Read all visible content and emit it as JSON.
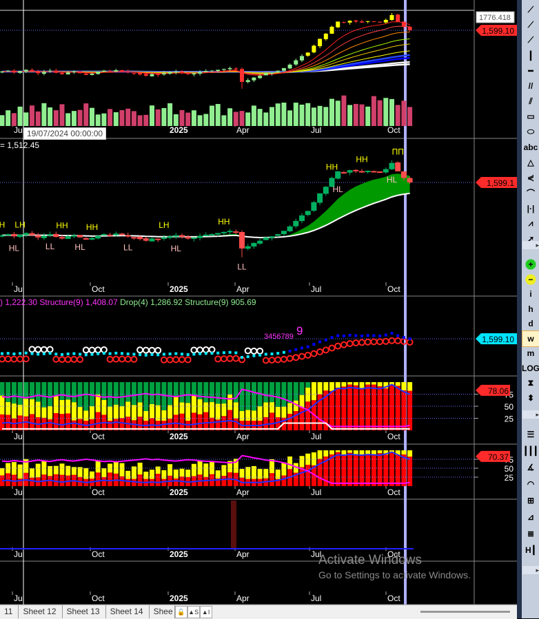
{
  "time_axis": [
    "Jul",
    "Oct",
    "2025",
    "Apr",
    "Jul",
    "Oct"
  ],
  "tooltip": "19/07/2024 00:00:00",
  "price_pane": {
    "high_label": "1776.418",
    "last_label": "1,599.10"
  },
  "swing_pane": {
    "header": "= 1,512.45",
    "last_label": "1,599.1",
    "swing_labels": [
      {
        "text": "H",
        "bar": 0,
        "kind": "high"
      },
      {
        "text": "LH",
        "bar": 3,
        "kind": "high"
      },
      {
        "text": "HL",
        "bar": 2,
        "kind": "low"
      },
      {
        "text": "LL",
        "bar": 8,
        "kind": "low"
      },
      {
        "text": "HH",
        "bar": 10,
        "kind": "high"
      },
      {
        "text": "HL",
        "bar": 13,
        "kind": "low"
      },
      {
        "text": "HH",
        "bar": 15,
        "kind": "high"
      },
      {
        "text": "LL",
        "bar": 21,
        "kind": "low"
      },
      {
        "text": "LH",
        "bar": 27,
        "kind": "high"
      },
      {
        "text": "HL",
        "bar": 29,
        "kind": "low"
      },
      {
        "text": "HH",
        "bar": 37,
        "kind": "high"
      },
      {
        "text": "LL",
        "bar": 40,
        "kind": "low"
      },
      {
        "text": "HH",
        "bar": 55,
        "kind": "high"
      },
      {
        "text": "HL",
        "bar": 56,
        "kind": "low"
      },
      {
        "text": "HH",
        "bar": 60,
        "kind": "high"
      },
      {
        "text": "HL",
        "bar": 65,
        "kind": "low"
      },
      {
        "text": "ПП",
        "bar": 66,
        "kind": "high"
      }
    ]
  },
  "structure_pane": {
    "header_parts": [
      {
        "text": ") 1,222.30 Structure(9) 1,408.07",
        "color": "#ff33ff"
      },
      {
        "text": " Drop(4) 1,286.92 Structure(9) 905.69",
        "color": "#90ee90"
      }
    ],
    "count_text": "3456789",
    "count_big": "9",
    "last_label": "1,599.10"
  },
  "osc1": {
    "last_label": "78.06",
    "levels": [
      "75",
      "50",
      "25"
    ]
  },
  "osc2": {
    "last_label": "70.37",
    "levels": [
      "75",
      "50",
      "25"
    ]
  },
  "closes": [
    1120,
    1130,
    1110,
    1125,
    1140,
    1120,
    1100,
    1115,
    1130,
    1105,
    1090,
    1110,
    1120,
    1100,
    1080,
    1095,
    1115,
    1130,
    1120,
    1135,
    1125,
    1110,
    1100,
    1085,
    1070,
    1090,
    1080,
    1100,
    1110,
    1120,
    1105,
    1090,
    1100,
    1115,
    1125,
    1130,
    1140,
    1150,
    1160,
    1145,
    1000,
    1020,
    1050,
    1070,
    1100,
    1110,
    1130,
    1160,
    1200,
    1250,
    1300,
    1340,
    1420,
    1500,
    1560,
    1640,
    1700,
    1690,
    1710,
    1700,
    1690,
    1705,
    1700,
    1690,
    1720,
    1776,
    1700,
    1640,
    1599
  ],
  "colors": {
    "up": "#00b060",
    "down": "#ff4c4c",
    "vol_up": "#90ee90",
    "vol_down": "#d0406a",
    "ribbon": "#009900",
    "label_red": "#ff2a2a",
    "label_cyan": "#00e5ff"
  },
  "tabs": [
    "11",
    "Sheet 12",
    "Sheet 13",
    "Sheet 14",
    "Shee"
  ],
  "tab_buttons": [
    "🔓",
    "▲S",
    "▲I"
  ],
  "toolbar": [
    {
      "icon": "line-segment-icon",
      "glyph": "⟋"
    },
    {
      "icon": "ray-icon",
      "glyph": "⟋"
    },
    {
      "icon": "extended-line-icon",
      "glyph": "⟋"
    },
    {
      "icon": "vertical-line-icon",
      "glyph": "┃"
    },
    {
      "icon": "horizontal-line-icon",
      "glyph": "━"
    },
    {
      "icon": "parallel-lines-icon",
      "glyph": "//"
    },
    {
      "icon": "pitchfork-icon",
      "glyph": "⫽"
    },
    {
      "icon": "rectangle-icon",
      "glyph": "▭"
    },
    {
      "icon": "ellipse-icon",
      "glyph": "⬭"
    },
    {
      "icon": "text-icon",
      "glyph": "abc"
    },
    {
      "icon": "triangle-icon",
      "glyph": "△"
    },
    {
      "icon": "gann-fan-icon",
      "glyph": "⋞"
    },
    {
      "icon": "arc-icon",
      "glyph": "⌒"
    },
    {
      "icon": "cycles-icon",
      "glyph": "|·|"
    },
    {
      "icon": "zigzag-icon",
      "glyph": "⩘"
    },
    {
      "icon": "arrow-icon",
      "glyph": "➚"
    }
  ],
  "toolbar2": [
    {
      "icon": "zoom-in-icon",
      "glyph": "+"
    },
    {
      "icon": "zoom-out-icon",
      "glyph": "−"
    },
    {
      "icon": "intraday-icon",
      "glyph": "i"
    },
    {
      "icon": "hourly-icon",
      "glyph": "h"
    },
    {
      "icon": "daily-icon",
      "glyph": "d"
    },
    {
      "icon": "weekly-icon",
      "glyph": "w"
    },
    {
      "icon": "monthly-icon",
      "glyph": "m"
    },
    {
      "icon": "log-scale-icon",
      "glyph": "LOG"
    },
    {
      "icon": "fit-icon",
      "glyph": "⧗"
    },
    {
      "icon": "scale-icon",
      "glyph": "⬍"
    }
  ],
  "toolbar3": [
    {
      "icon": "fib-retracement-icon",
      "glyph": "☰"
    },
    {
      "icon": "fib-timezones-icon",
      "glyph": "┃┃┃"
    },
    {
      "icon": "fib-fan-icon",
      "glyph": "∡"
    },
    {
      "icon": "fib-arcs-icon",
      "glyph": "◠"
    },
    {
      "icon": "grid-icon",
      "glyph": "⊞"
    },
    {
      "icon": "gann-square-icon",
      "glyph": "⊿"
    },
    {
      "icon": "fib-extension-icon",
      "glyph": "≣"
    },
    {
      "icon": "cycles-lines-icon",
      "glyph": "H┃"
    }
  ],
  "watermark": {
    "title": "Activate Windows",
    "subtitle": "Go to Settings to activate Windows."
  }
}
